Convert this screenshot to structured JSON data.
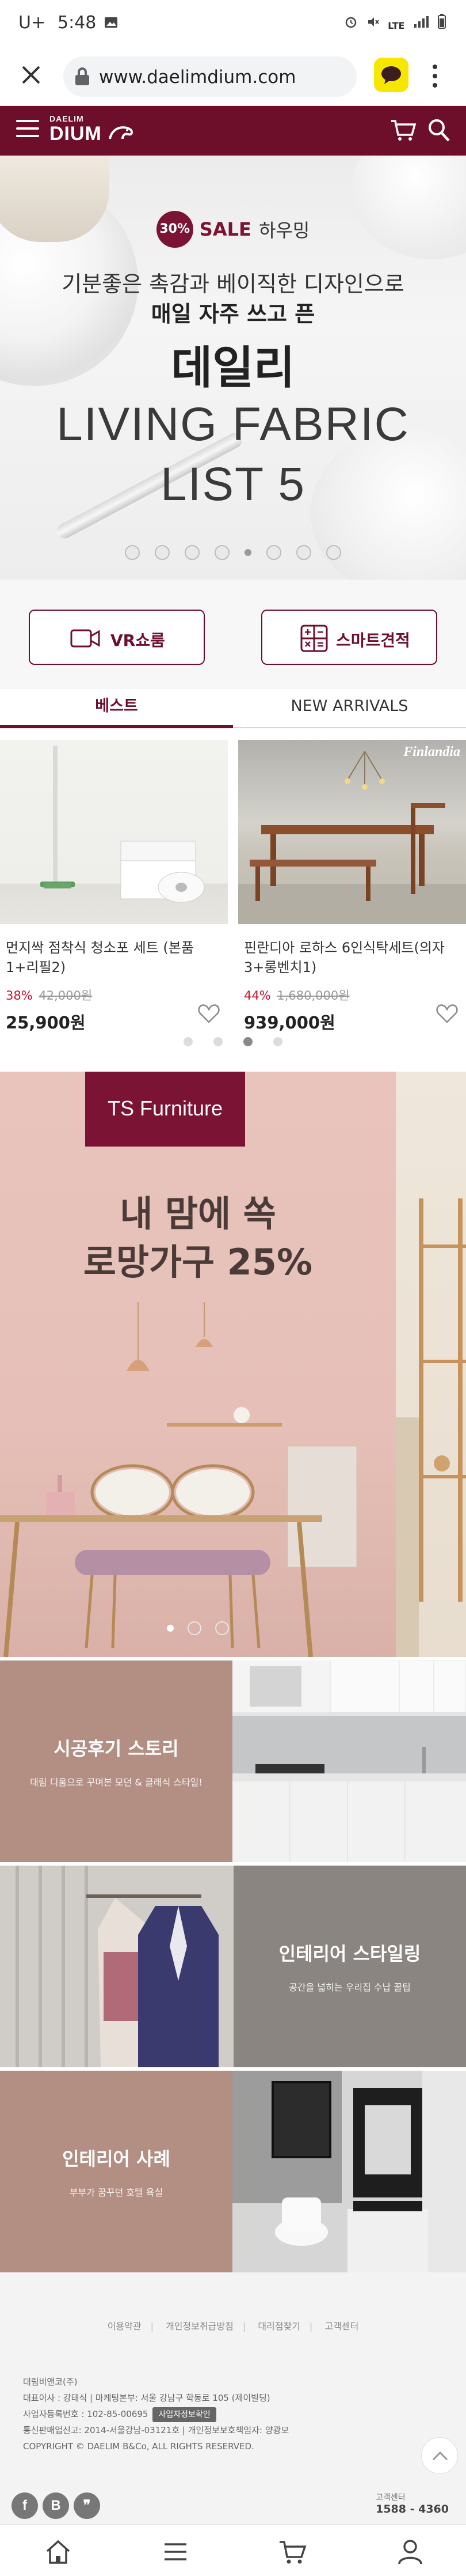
{
  "status_bar": {
    "carrier": "U+",
    "time": "5:48",
    "icons": [
      "alarm-icon",
      "mute-icon",
      "lte-icon",
      "signal-icon",
      "battery-icon"
    ],
    "network": "LTE"
  },
  "browser": {
    "url": "www.daelimdium.com",
    "close_icon": "close-icon",
    "lock_icon": "lock-icon",
    "kakao_icon": "kakaotalk-icon",
    "more_icon": "more-vertical-icon"
  },
  "header": {
    "logo_small": "DAELIM",
    "logo_big": "DIUM",
    "menu_icon": "hamburger-icon",
    "cart_icon": "cart-icon",
    "search_icon": "search-icon",
    "brand_color": "#6d0e2b"
  },
  "hero": {
    "badge": "30%",
    "sale": "SALE",
    "sale_suffix": "하우밍",
    "line1": "기분좋은 촉감과 베이직한 디자인으로",
    "line2": "매일 자주 쓰고 픈",
    "line3": "데일리",
    "line4": "LIVING FABRIC",
    "line5": "LIST 5",
    "slide_count": 8,
    "active_slide": 5
  },
  "quick_buttons": {
    "vr_label": "VR쇼룸",
    "vr_icon": "video-camera-icon",
    "smart_label": "스마트견적",
    "smart_icon": "calculator-icon"
  },
  "tabs": [
    {
      "label": "베스트",
      "active": true
    },
    {
      "label": "NEW ARRIVALS",
      "active": false
    }
  ],
  "products": [
    {
      "name": "먼지싹 점착식 청소포 세트 (본품1+리필2)",
      "discount": "38%",
      "original_price": "42,000원",
      "price": "25,900원",
      "heart_icon": "heart-icon"
    },
    {
      "name": "핀란디아 로하스 6인식탁세트(의자3+롱벤치1)",
      "discount": "44%",
      "original_price": "1,680,000원",
      "price": "939,000원",
      "image_brand": "Finlandia",
      "heart_icon": "heart-icon"
    }
  ],
  "products_carousel": {
    "count": 4,
    "active": 3
  },
  "promo": {
    "label": "TS Furniture",
    "head1": "내 맘에 쏙",
    "head2": "로망가구 25%",
    "dots": 3,
    "active_dot": 1
  },
  "features": [
    {
      "title": "시공후기 스토리",
      "subtitle": "대림 디움으로 꾸며본 모던 & 클래식 스타일!"
    },
    {
      "title": "인테리어 스타일링",
      "subtitle": "공간을 넓히는 우리집 수납 꿀팁"
    },
    {
      "title": "인테리어 사례",
      "subtitle": "부부가 꿈꾸던 호텔 욕실"
    }
  ],
  "footer": {
    "links": [
      "이용약관",
      "개인정보취급방침",
      "대리점찾기",
      "고객센터"
    ],
    "company": "대림비앤코(주)",
    "ceo": "대표이사 : 강태식 | 마케팅본부: 서울 강남구 학동로 105 (제이빌딩)",
    "biz_no": "사업자등록번호 : 102-85-00695",
    "biz_btn": "사업자정보확인",
    "mail_order": "통신판매업신고: 2014-서울강남-03121호 | 개인정보보호책임자: 양광모",
    "copyright": "COPYRIGHT © DAELIM B&Co, ALL RIGHTS RESERVED.",
    "cs_label": "고객센터",
    "cs_number": "1588 - 4360",
    "social": [
      "facebook-icon",
      "blog-icon",
      "kakaostory-icon"
    ],
    "top_icon": "chevron-up-icon"
  },
  "bottom_nav": [
    "home-icon",
    "menu-icon",
    "cart-icon",
    "user-icon"
  ]
}
